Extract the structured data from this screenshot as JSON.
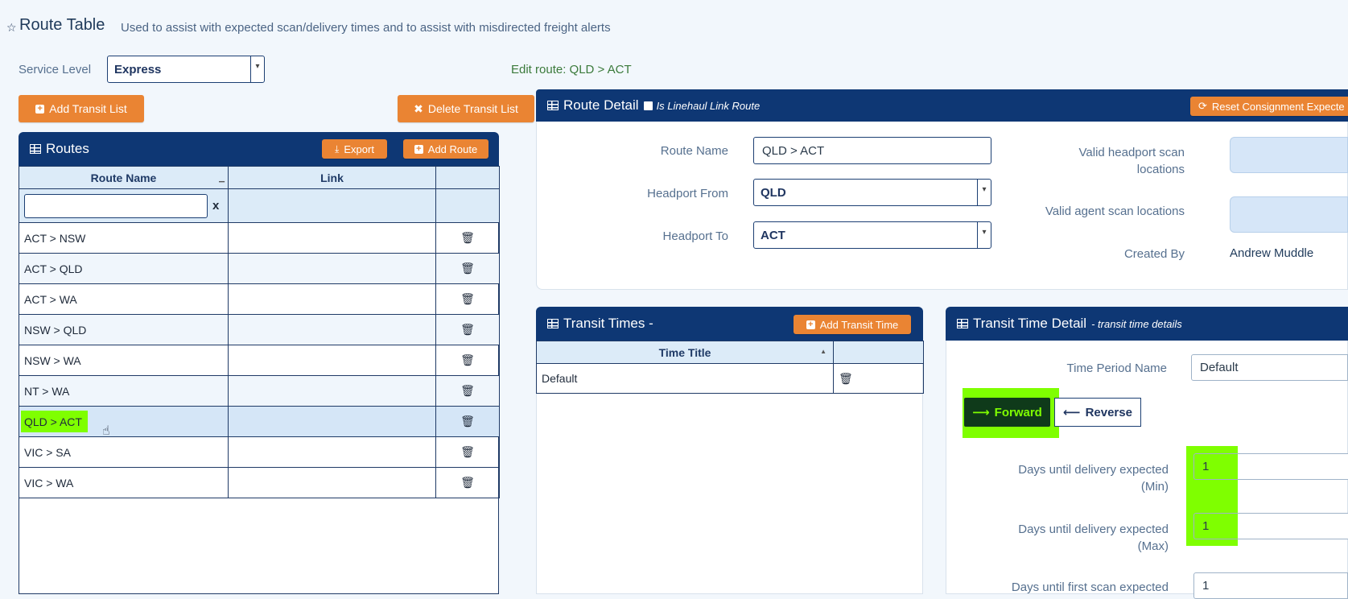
{
  "page": {
    "star": "☆",
    "title": "Route Table",
    "subtitle": "Used to assist with expected scan/delivery times and to assist with misdirected freight alerts"
  },
  "service_level": {
    "label": "Service Level",
    "value": "Express"
  },
  "edit_message": "Edit route: QLD > ACT",
  "toolbar": {
    "add_transit_list": "Add Transit List",
    "delete_transit_list": "Delete Transit List"
  },
  "routes": {
    "title": "Routes",
    "export": "Export",
    "add_route": "Add Route",
    "col_route_name": "Route Name",
    "col_link": "Link",
    "filter_clear": "x",
    "rows": [
      {
        "name": "ACT > NSW",
        "link": ""
      },
      {
        "name": "ACT > QLD",
        "link": ""
      },
      {
        "name": "ACT > WA",
        "link": ""
      },
      {
        "name": "NSW > QLD",
        "link": ""
      },
      {
        "name": "NSW > WA",
        "link": ""
      },
      {
        "name": "NT > WA",
        "link": ""
      },
      {
        "name": "QLD > ACT",
        "link": ""
      },
      {
        "name": "VIC > SA",
        "link": ""
      },
      {
        "name": "VIC > WA",
        "link": ""
      }
    ],
    "selected_index": 6
  },
  "route_detail": {
    "title": "Route Detail",
    "linehaul_label": "Is Linehaul Link Route",
    "reset_button": "Reset Consignment Expecte",
    "route_name_label": "Route Name",
    "route_name_value": "QLD > ACT",
    "headport_from_label": "Headport From",
    "headport_from_value": "QLD",
    "headport_to_label": "Headport To",
    "headport_to_value": "ACT",
    "valid_headport_label_1": "Valid headport scan",
    "valid_headport_label_2": "locations",
    "valid_agent_label": "Valid agent scan locations",
    "created_by_label": "Created By",
    "created_by_value": "Andrew Muddle"
  },
  "transit_times": {
    "title": "Transit Times -",
    "add_button": "Add Transit Time",
    "col_time_title": "Time Title",
    "rows": [
      {
        "title": "Default"
      }
    ]
  },
  "transit_detail": {
    "title": "Transit Time Detail",
    "subtitle": "- transit time details",
    "period_label": "Time Period Name",
    "period_value": "Default",
    "forward": "Forward",
    "reverse": "Reverse",
    "min_label_1": "Days until delivery expected",
    "min_label_2": "(Min)",
    "min_value": "1",
    "max_label_1": "Days until delivery expected",
    "max_label_2": "(Max)",
    "max_value": "1",
    "first_scan_label": "Days until first scan expected",
    "first_scan_value": "1"
  },
  "colors": {
    "header_navy": "#0e3774",
    "accent_orange": "#ea8433",
    "highlight_green": "#7fff00"
  }
}
